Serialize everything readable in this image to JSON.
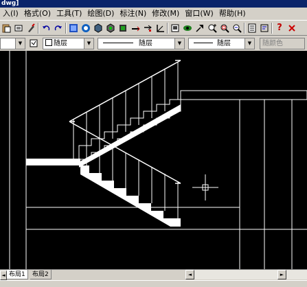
{
  "window": {
    "title_fragment": "dwg]"
  },
  "menu": {
    "items": [
      {
        "label": "入(I)",
        "name": "menu-insert"
      },
      {
        "label": "格式(O)",
        "name": "menu-format"
      },
      {
        "label": "工具(T)",
        "name": "menu-tools"
      },
      {
        "label": "绘图(D)",
        "name": "menu-draw"
      },
      {
        "label": "标注(N)",
        "name": "menu-dimension"
      },
      {
        "label": "修改(M)",
        "name": "menu-modify"
      },
      {
        "label": "窗口(W)",
        "name": "menu-window"
      },
      {
        "label": "帮助(H)",
        "name": "menu-help"
      }
    ]
  },
  "toolbar": {
    "icons": [
      "paste-icon",
      "match-properties-icon",
      "brush-icon",
      "undo-icon",
      "redo-icon",
      "publish-icon",
      "hyperlink-icon",
      "object-snap-icon",
      "tracking-icon",
      "ucs-icon",
      "distance-icon",
      "named-views-icon",
      "pan-icon",
      "zoom-realtime-icon",
      "zoom-window-icon",
      "zoom-previous-icon",
      "properties-icon",
      "design-center-icon",
      "help-icon",
      "extra-icon"
    ]
  },
  "properties": {
    "layer_value": "随层",
    "linetype_value": "随层",
    "lineweight_value": "随层",
    "plotstyle_value": "随颜色"
  },
  "layout_tabs": [
    {
      "label": "布局1",
      "active": true
    },
    {
      "label": "布局2",
      "active": false
    }
  ],
  "colors": {
    "canvas_bg": "#000000",
    "line": "#ffffff",
    "titlebar": "#0a246a",
    "chrome": "#d4d0c8"
  }
}
